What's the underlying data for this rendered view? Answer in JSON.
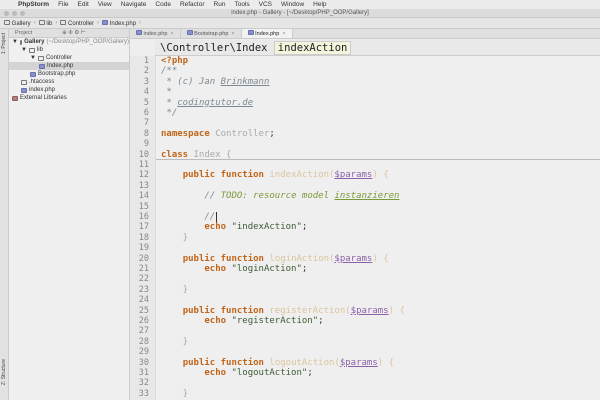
{
  "menubar": {
    "apple": "",
    "app": "PhpStorm",
    "items": [
      "File",
      "Edit",
      "View",
      "Navigate",
      "Code",
      "Refactor",
      "Run",
      "Tools",
      "VCS",
      "Window",
      "Help"
    ]
  },
  "window_title": "index.php - Gallery - [~/Desktop/PHP_OOP/Gallery]",
  "breadcrumbs": [
    "Gallery",
    "lib",
    "Controller",
    "Index.php"
  ],
  "left_strip": {
    "project": "1: Project",
    "structure": "Z: Structure"
  },
  "project_panel": {
    "title": "Project",
    "tree": [
      {
        "label": "Gallery",
        "extra": " (~/Desktop/PHP_OOP/Gallery)",
        "depth": 0,
        "icon": "folder",
        "arrow": "▼"
      },
      {
        "label": "lib",
        "depth": 1,
        "icon": "folder",
        "arrow": "▼"
      },
      {
        "label": "Controller",
        "depth": 2,
        "icon": "folder",
        "arrow": "▼"
      },
      {
        "label": "Index.php",
        "depth": 3,
        "icon": "php",
        "selected": true
      },
      {
        "label": "Bootstrap.php",
        "depth": 2,
        "icon": "php"
      },
      {
        "label": ".htaccess",
        "depth": 1,
        "icon": "file"
      },
      {
        "label": "index.php",
        "depth": 1,
        "icon": "php"
      },
      {
        "label": "External Libraries",
        "depth": 0,
        "icon": "lib"
      }
    ]
  },
  "tabs": [
    {
      "label": "index.php",
      "active": false
    },
    {
      "label": "Bootstrap.php",
      "active": false
    },
    {
      "label": "Index.php",
      "active": true
    }
  ],
  "navbar": {
    "path": "\\Controller\\Index",
    "method": "indexAction"
  },
  "code": [
    [
      [
        "tag",
        "<?php"
      ]
    ],
    [
      [
        "cm",
        "/**"
      ]
    ],
    [
      [
        "cm",
        " * (c) Jan "
      ],
      [
        "cm ul",
        "Brinkmann"
      ]
    ],
    [
      [
        "cm",
        " *"
      ]
    ],
    [
      [
        "cm",
        " * "
      ],
      [
        "cm ul",
        "codingtutor.de"
      ]
    ],
    [
      [
        "cm",
        " */"
      ]
    ],
    [],
    [
      [
        "kw",
        "namespace "
      ],
      [
        "cls",
        "Controller"
      ],
      [
        "pl",
        ";"
      ]
    ],
    [],
    [
      [
        "kw",
        "class "
      ],
      [
        "cls",
        "Index {"
      ]
    ],
    [],
    [
      [
        "pl",
        "    "
      ],
      [
        "kw",
        "public function "
      ],
      [
        "fn",
        "indexAction("
      ],
      [
        "var",
        "$params"
      ],
      [
        "fn",
        ") {"
      ]
    ],
    [],
    [
      [
        "pl",
        "        "
      ],
      [
        "cm",
        "// "
      ],
      [
        "todo",
        "TODO: resource model "
      ],
      [
        "todo ul",
        "instanzieren"
      ]
    ],
    [],
    [
      [
        "pl",
        "        "
      ],
      [
        "cm",
        "//"
      ],
      [
        "cur",
        " "
      ]
    ],
    [
      [
        "pl",
        "        "
      ],
      [
        "ec",
        "echo "
      ],
      [
        "str",
        "\"indexAction\""
      ],
      [
        "pl",
        ";"
      ]
    ],
    [
      [
        "cls",
        "    }"
      ]
    ],
    [],
    [
      [
        "pl",
        "    "
      ],
      [
        "kw",
        "public function "
      ],
      [
        "fn",
        "loginAction("
      ],
      [
        "var",
        "$params"
      ],
      [
        "fn",
        ") {"
      ]
    ],
    [
      [
        "pl",
        "        "
      ],
      [
        "ec",
        "echo "
      ],
      [
        "str",
        "\"loginAction\""
      ],
      [
        "pl",
        ";"
      ]
    ],
    [],
    [
      [
        "cls",
        "    }"
      ]
    ],
    [],
    [
      [
        "pl",
        "    "
      ],
      [
        "kw",
        "public function "
      ],
      [
        "fn",
        "registerAction("
      ],
      [
        "var",
        "$params"
      ],
      [
        "fn",
        ") {"
      ]
    ],
    [
      [
        "pl",
        "        "
      ],
      [
        "ec",
        "echo "
      ],
      [
        "str",
        "\"registerAction\""
      ],
      [
        "pl",
        ";"
      ]
    ],
    [],
    [
      [
        "cls",
        "    }"
      ]
    ],
    [],
    [
      [
        "pl",
        "    "
      ],
      [
        "kw",
        "public function "
      ],
      [
        "fn",
        "logoutAction("
      ],
      [
        "var",
        "$params"
      ],
      [
        "fn",
        ") {"
      ]
    ],
    [
      [
        "pl",
        "        "
      ],
      [
        "ec",
        "echo "
      ],
      [
        "str",
        "\"logoutAction\""
      ],
      [
        "pl",
        ";"
      ]
    ],
    [],
    [
      [
        "cls",
        "    }"
      ]
    ]
  ]
}
